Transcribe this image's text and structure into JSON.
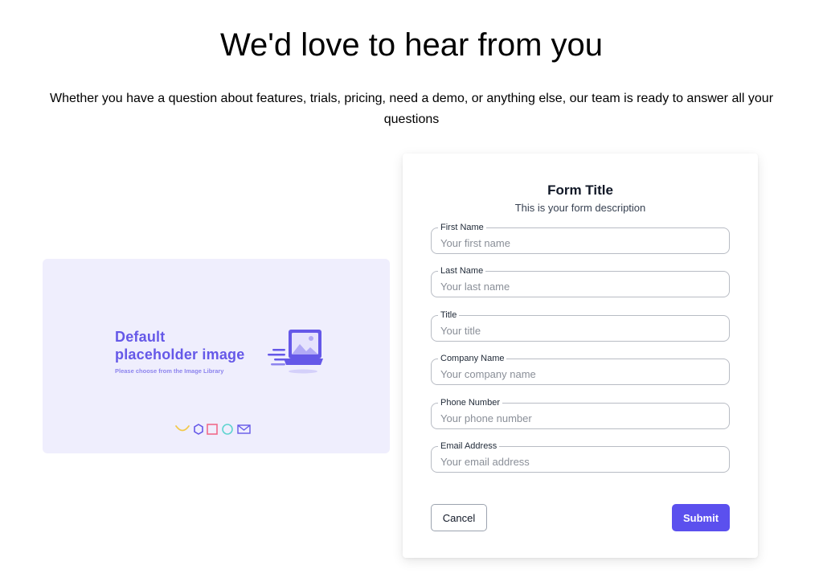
{
  "hero": {
    "title": "We'd love to hear from you",
    "subtitle": "Whether you have a question about features, trials, pricing, need a demo, or anything else, our team is ready to answer all your questions"
  },
  "placeholder": {
    "heading_line1": "Default",
    "heading_line2": "placeholder image",
    "caption": "Please choose from the Image Library",
    "colors": {
      "background": "#efeefd",
      "accent": "#6558e8"
    },
    "icons": [
      "smile-shape-icon",
      "hexagon-icon",
      "square-icon",
      "circle-icon",
      "envelope-icon"
    ]
  },
  "form": {
    "title": "Form Title",
    "description": "This is your form description",
    "fields": [
      {
        "label": "First Name",
        "placeholder": "Your first name",
        "value": ""
      },
      {
        "label": "Last Name",
        "placeholder": "Your last name",
        "value": ""
      },
      {
        "label": "Title",
        "placeholder": "Your title",
        "value": ""
      },
      {
        "label": "Company Name",
        "placeholder": "Your company name",
        "value": ""
      },
      {
        "label": "Phone Number",
        "placeholder": "Your phone number",
        "value": ""
      },
      {
        "label": "Email Address",
        "placeholder": "Your email address",
        "value": ""
      }
    ],
    "cancel_label": "Cancel",
    "submit_label": "Submit",
    "colors": {
      "submit_background": "#5b50ee"
    }
  }
}
